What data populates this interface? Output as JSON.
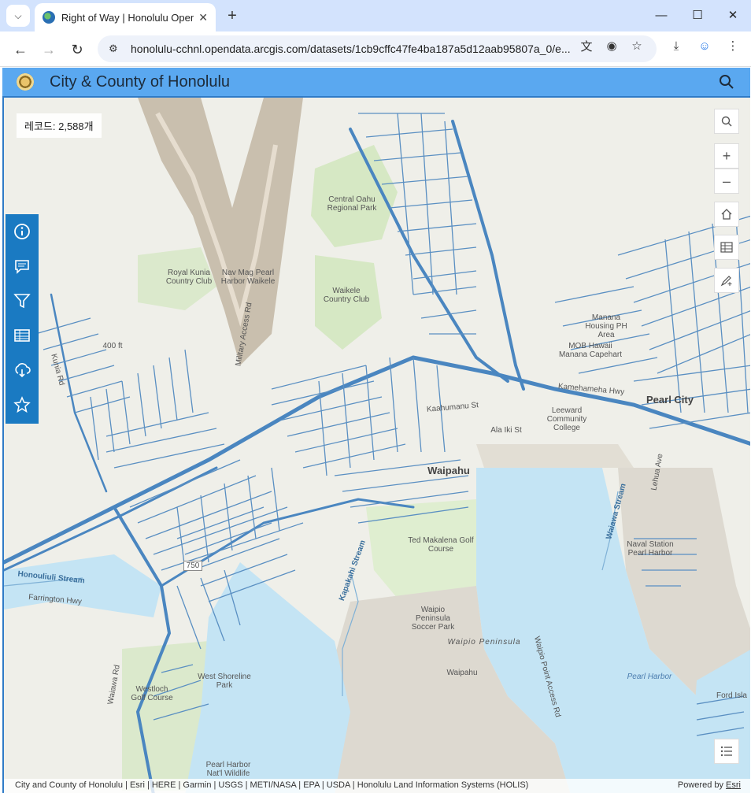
{
  "browser": {
    "tab_title": "Right of Way | Honolulu Open",
    "url": "honolulu-cchnl.opendata.arcgis.com/datasets/1cb9cffc47fe4ba187a5d12aab95807a_0/e..."
  },
  "site": {
    "title": "City & County of Honolulu"
  },
  "map": {
    "record_count": "레코드: 2,588개",
    "labels": {
      "central_oahu": "Central Oahu Regional Park",
      "royal_kunia": "Royal Kunia Country Club",
      "nav_mag": "Nav Mag Pearl Harbor Waikele",
      "waikele_cc": "Waikele Country Club",
      "manana": "Manana Housing PH Area",
      "mob_hawaii": "MOB Hawaii Manana Capehart",
      "pearl_city": "Pearl City",
      "leeward": "Leeward Community College",
      "waipahu_town": "Waipahu",
      "ala_iki": "Ala Iki St",
      "ted_makalena": "Ted Makalena Golf Course",
      "waipio_soccer": "Waipio Peninsula Soccer Park",
      "waipio_peninsula": "Waipio Peninsula",
      "waipahu_pen": "Waipahu",
      "naval_station": "Naval Station Pearl Harbor",
      "pearl_harbor_water": "Pearl Harbor",
      "west_shoreline": "West Shoreline Park",
      "westloch": "Westloch Golf Course",
      "pearl_harbor_wildlife": "Pearl Harbor Nat'l Wildlife",
      "ford_island": "Ford Isla",
      "honouliuli_stream": "Honouliuli Stream",
      "kapakahi_stream": "Kapakahi Stream",
      "waiawa_stream": "Waiawa Stream",
      "farrington": "Farrington Hwy",
      "kunia_rd": "Kunia Rd",
      "military_access": "Military Access Rd",
      "hwy_750": "750",
      "ft_400": "400 ft",
      "kamehameha": "Kamehameha Hwy",
      "waipio_access": "Waipio Point Access Rd",
      "lehua": "Lehua Ave",
      "waiawa_rd": "Waiawa Rd",
      "kaahumanu": "Kaahumanu St"
    }
  },
  "attribution": {
    "text": "City and County of Honolulu | Esri | HERE | Garmin | USGS | METI/NASA | EPA | USDA | Honolulu Land Information Systems (HOLIS)",
    "powered_by": "Powered by ",
    "esri": "Esri"
  },
  "icons": {
    "side_toolbar": [
      "info-icon",
      "comment-icon",
      "filter-icon",
      "table-icon",
      "download-icon",
      "star-icon"
    ],
    "map_controls": [
      "search-icon",
      "zoom-in-icon",
      "zoom-out-icon",
      "home-icon",
      "table-icon",
      "sketch-icon",
      "legend-icon"
    ]
  },
  "colors": {
    "header": "#5aa8f0",
    "toolbar": "#1a7ac2",
    "water": "#c4e4f4",
    "road": "#4a86c0"
  }
}
